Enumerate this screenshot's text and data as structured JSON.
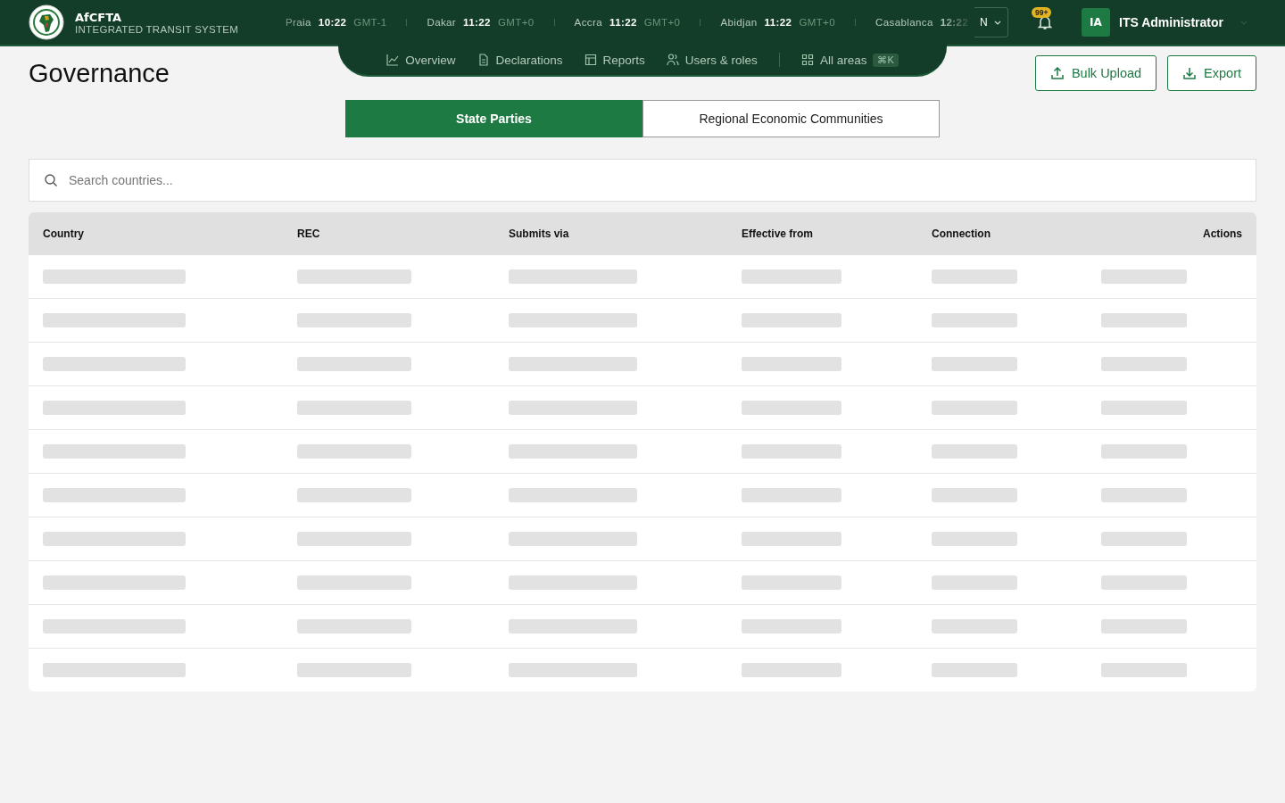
{
  "brand": {
    "name": "AfCFTA",
    "subtitle": "INTEGRATED TRANSIT SYSTEM"
  },
  "clocks": [
    {
      "city": "Praia",
      "time": "10:22",
      "zone": "GMT-1"
    },
    {
      "city": "Dakar",
      "time": "11:22",
      "zone": "GMT+0"
    },
    {
      "city": "Accra",
      "time": "11:22",
      "zone": "GMT+0"
    },
    {
      "city": "Abidjan",
      "time": "11:22",
      "zone": "GMT+0"
    },
    {
      "city": "Casablanca",
      "time": "12:22"
    }
  ],
  "language": "N",
  "notifications": {
    "badge": "99+"
  },
  "user": {
    "initials": "IA",
    "name": "ITS Administrator"
  },
  "nav": [
    {
      "label": "Overview",
      "kind": "chart"
    },
    {
      "label": "Declarations",
      "kind": "doc"
    },
    {
      "label": "Reports",
      "kind": "table"
    },
    {
      "label": "Users & roles",
      "kind": "users"
    },
    {
      "label": "All areas",
      "kind": "grid",
      "shortcut": "⌘K"
    }
  ],
  "page_title": "Governance",
  "actions": [
    {
      "label": "Bulk Upload",
      "kind": "upload"
    },
    {
      "label": "Export",
      "kind": "download"
    }
  ],
  "tabs": [
    {
      "label": "State Parties",
      "selected": true
    },
    {
      "label": "Regional Economic Communities",
      "selected": false
    }
  ],
  "search": {
    "placeholder": "Search countries..."
  },
  "table": {
    "columns": [
      "Country",
      "REC",
      "Submits via",
      "Effective from",
      "Connection",
      "Actions"
    ]
  }
}
